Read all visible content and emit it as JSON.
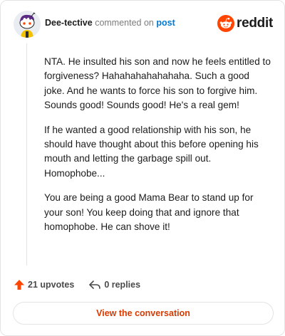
{
  "comment": {
    "author": "Dee-tective",
    "action_text": "commented on",
    "target_link": "post",
    "paragraphs": [
      "NTA. He insulted his son and now he feels entitled to forgiveness? Hahahahahahahaha. Such a good joke. And he wants to force his son to forgive him. Sounds good! Sounds good! He's a real gem!",
      "If he wanted a good relationship with his son, he should have thought about this before opening his mouth and letting the garbage spill out. Homophobe...",
      "You are being a good Mama Bear to stand up for your son! You keep doing that and ignore that homophobe. He can shove it!"
    ]
  },
  "brand": {
    "name": "reddit",
    "color": "#ff4500"
  },
  "actions": {
    "upvotes_label": "21 upvotes",
    "replies_label": "0 replies",
    "upvote_icon": "upvote-arrow-icon",
    "reply_icon": "reply-arrow-icon"
  },
  "cta": {
    "label": "View the conversation",
    "color": "#d93a00"
  }
}
